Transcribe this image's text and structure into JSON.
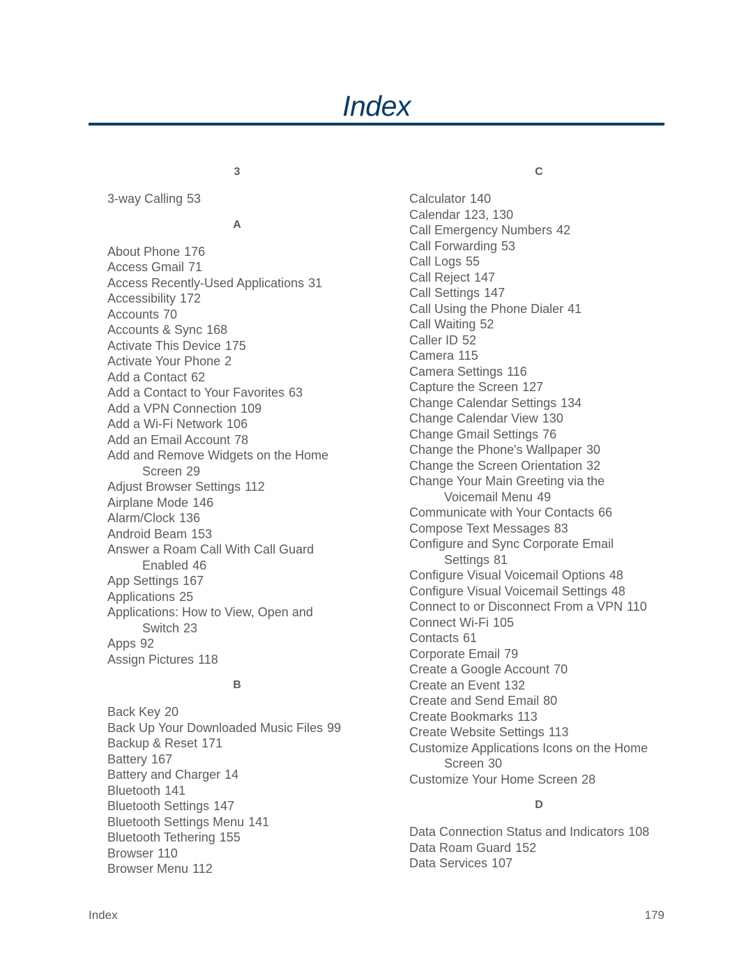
{
  "title": "Index",
  "columns": [
    {
      "sections": [
        {
          "letter": "3",
          "entries": [
            {
              "text": "3-way Calling",
              "page": "53"
            }
          ]
        },
        {
          "letter": "A",
          "entries": [
            {
              "text": "About Phone",
              "page": "176"
            },
            {
              "text": "Access Gmail",
              "page": "71"
            },
            {
              "text": "Access Recently-Used Applications",
              "page": "31"
            },
            {
              "text": "Accessibility",
              "page": "172"
            },
            {
              "text": "Accounts",
              "page": "70"
            },
            {
              "text": "Accounts & Sync",
              "page": "168"
            },
            {
              "text": "Activate This Device",
              "page": "175"
            },
            {
              "text": "Activate Your Phone",
              "page": "2"
            },
            {
              "text": "Add a Contact",
              "page": "62"
            },
            {
              "text": "Add a Contact to Your Favorites",
              "page": "63"
            },
            {
              "text": "Add a VPN Connection",
              "page": "109"
            },
            {
              "text": "Add a Wi-Fi Network",
              "page": "106"
            },
            {
              "text": "Add an Email Account",
              "page": "78"
            },
            {
              "text": "Add and Remove Widgets on the Home",
              "cont": "Screen",
              "page": "29"
            },
            {
              "text": "Adjust Browser Settings",
              "page": "112"
            },
            {
              "text": "Airplane Mode",
              "page": "146"
            },
            {
              "text": "Alarm/Clock",
              "page": "136"
            },
            {
              "text": "Android Beam",
              "page": "153"
            },
            {
              "text": "Answer a Roam Call With Call Guard",
              "cont": "Enabled",
              "page": "46"
            },
            {
              "text": "App Settings",
              "page": "167"
            },
            {
              "text": "Applications",
              "page": "25"
            },
            {
              "text": "Applications: How to View, Open and",
              "cont": "Switch",
              "page": "23"
            },
            {
              "text": "Apps",
              "page": "92"
            },
            {
              "text": "Assign Pictures",
              "page": "118"
            }
          ]
        },
        {
          "letter": "B",
          "entries": [
            {
              "text": "Back Key",
              "page": "20"
            },
            {
              "text": "Back Up Your Downloaded Music Files",
              "page": "99"
            },
            {
              "text": "Backup & Reset",
              "page": "171"
            },
            {
              "text": "Battery",
              "page": "167"
            },
            {
              "text": "Battery and Charger",
              "page": "14"
            },
            {
              "text": "Bluetooth",
              "page": "141"
            },
            {
              "text": "Bluetooth Settings",
              "page": "147"
            },
            {
              "text": "Bluetooth Settings Menu",
              "page": "141"
            },
            {
              "text": "Bluetooth Tethering",
              "page": "155"
            },
            {
              "text": "Browser",
              "page": "110"
            },
            {
              "text": "Browser Menu",
              "page": "112"
            }
          ]
        }
      ]
    },
    {
      "sections": [
        {
          "letter": "C",
          "entries": [
            {
              "text": "Calculator",
              "page": "140"
            },
            {
              "text": "Calendar",
              "page": "123, 130"
            },
            {
              "text": "Call Emergency Numbers",
              "page": "42"
            },
            {
              "text": "Call Forwarding",
              "page": "53"
            },
            {
              "text": "Call Logs",
              "page": "55"
            },
            {
              "text": "Call Reject",
              "page": "147"
            },
            {
              "text": "Call Settings",
              "page": "147"
            },
            {
              "text": "Call Using the Phone Dialer",
              "page": "41"
            },
            {
              "text": "Call Waiting",
              "page": "52"
            },
            {
              "text": "Caller ID",
              "page": "52"
            },
            {
              "text": "Camera",
              "page": "115"
            },
            {
              "text": "Camera Settings",
              "page": "116"
            },
            {
              "text": "Capture the Screen",
              "page": "127"
            },
            {
              "text": "Change Calendar Settings",
              "page": "134"
            },
            {
              "text": "Change Calendar View",
              "page": "130"
            },
            {
              "text": "Change Gmail Settings",
              "page": "76"
            },
            {
              "text": "Change the Phone's Wallpaper",
              "page": "30"
            },
            {
              "text": "Change the Screen Orientation",
              "page": "32"
            },
            {
              "text": "Change Your Main Greeting via the",
              "cont": "Voicemail Menu",
              "page": "49"
            },
            {
              "text": "Communicate with Your Contacts",
              "page": "66"
            },
            {
              "text": "Compose Text Messages",
              "page": "83"
            },
            {
              "text": "Configure and Sync Corporate Email",
              "cont": "Settings",
              "page": "81"
            },
            {
              "text": "Configure Visual Voicemail Options",
              "page": "48"
            },
            {
              "text": "Configure Visual Voicemail Settings",
              "page": "48"
            },
            {
              "text": "Connect to or Disconnect From a VPN",
              "page": "110"
            },
            {
              "text": "Connect Wi-Fi",
              "page": "105"
            },
            {
              "text": "Contacts",
              "page": "61"
            },
            {
              "text": "Corporate Email",
              "page": "79"
            },
            {
              "text": "Create a Google Account",
              "page": "70"
            },
            {
              "text": "Create an Event",
              "page": "132"
            },
            {
              "text": "Create and Send Email",
              "page": "80"
            },
            {
              "text": "Create Bookmarks",
              "page": "113"
            },
            {
              "text": "Create Website Settings",
              "page": "113"
            },
            {
              "text": "Customize Applications Icons on the Home",
              "cont": "Screen",
              "page": "30"
            },
            {
              "text": "Customize Your Home Screen",
              "page": "28"
            }
          ]
        },
        {
          "letter": "D",
          "entries": [
            {
              "text": "Data Connection Status and Indicators",
              "page": "108"
            },
            {
              "text": "Data Roam Guard",
              "page": "152"
            },
            {
              "text": "Data Services",
              "page": "107"
            }
          ]
        }
      ]
    }
  ],
  "footer": {
    "section": "Index",
    "page_number": "179"
  }
}
